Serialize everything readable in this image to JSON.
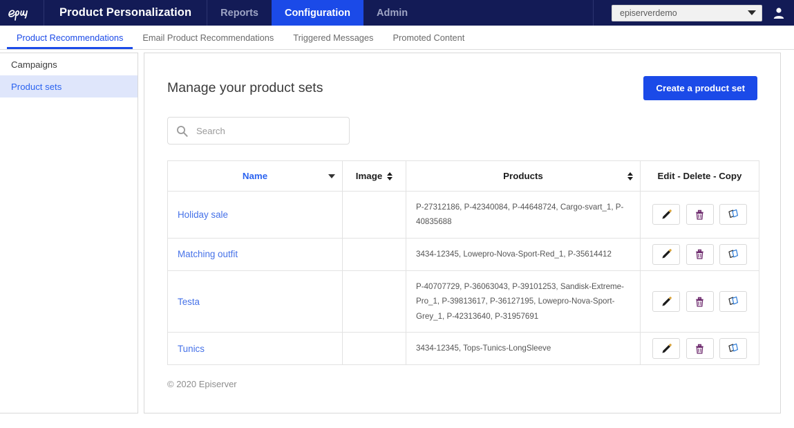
{
  "topnav": {
    "logo_icon": "epi-logo-icon",
    "brand": "Product Personalization",
    "items": [
      {
        "label": "Reports",
        "active": false
      },
      {
        "label": "Configuration",
        "active": true
      },
      {
        "label": "Admin",
        "active": false
      }
    ],
    "account": {
      "value": "episerverdemo",
      "caret_icon": "chevron-down-icon"
    },
    "avatar_icon": "user-avatar-icon",
    "active_tab_color": "#1b4ae8",
    "background_color": "#131b56"
  },
  "subnav": {
    "items": [
      {
        "label": "Product Recommendations",
        "active": true
      },
      {
        "label": "Email Product Recommendations",
        "active": false
      },
      {
        "label": "Triggered Messages",
        "active": false
      },
      {
        "label": "Promoted Content",
        "active": false
      }
    ],
    "active_color": "#1b4ae8"
  },
  "sidebar": {
    "items": [
      {
        "label": "Campaigns",
        "active": false
      },
      {
        "label": "Product sets",
        "active": true
      }
    ],
    "active_background": "#dfe6fb",
    "active_color": "#2b63f0"
  },
  "main": {
    "title": "Manage your product sets",
    "create_button": "Create a product set",
    "search": {
      "placeholder": "Search",
      "value": "",
      "icon": "search-icon"
    },
    "table": {
      "columns": [
        {
          "label": "Name",
          "sort": "desc",
          "active": true
        },
        {
          "label": "Image",
          "sort": "both",
          "active": false
        },
        {
          "label": "Products",
          "sort": "both",
          "active": false
        },
        {
          "label": "Edit - Delete - Copy",
          "sort": "none",
          "active": false
        }
      ],
      "rows": [
        {
          "name": "Holiday sale",
          "image": "",
          "products": "P-27312186, P-42340084, P-44648724, Cargo-svart_1, P-40835688"
        },
        {
          "name": "Matching outfit",
          "image": "",
          "products": "3434-12345, Lowepro-Nova-Sport-Red_1, P-35614412"
        },
        {
          "name": "Testa",
          "image": "",
          "products": "P-40707729, P-36063043, P-39101253, Sandisk-Extreme-Pro_1, P-39813617, P-36127195, Lowepro-Nova-Sport-Grey_1, P-42313640, P-31957691"
        },
        {
          "name": "Tunics",
          "image": "",
          "products": "3434-12345, Tops-Tunics-LongSleeve"
        }
      ],
      "row_actions": [
        {
          "name": "edit",
          "icon": "pencil-icon"
        },
        {
          "name": "delete",
          "icon": "trash-icon"
        },
        {
          "name": "copy",
          "icon": "copy-icon"
        }
      ]
    },
    "footer": "© 2020 Episerver"
  }
}
